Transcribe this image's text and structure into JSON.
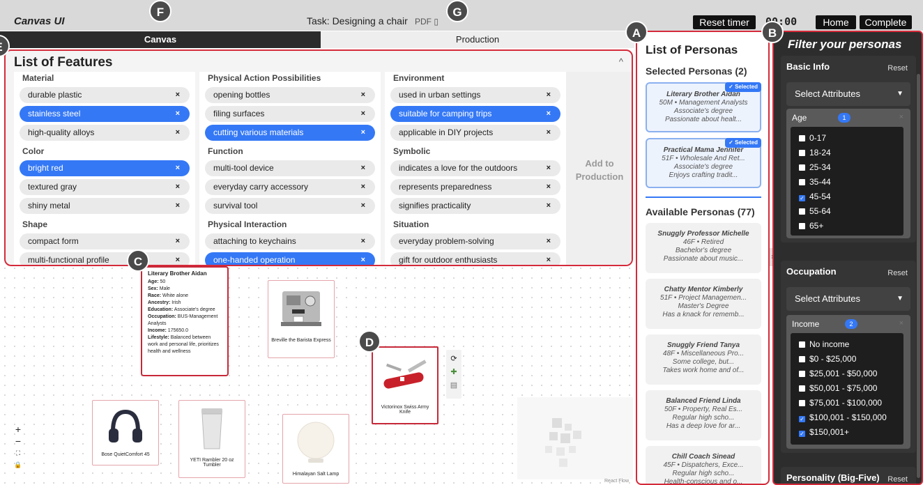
{
  "topbar": {
    "app_title": "Canvas UI",
    "task": "Task: Designing a chair",
    "pdf_label": "PDF",
    "reset_timer": "Reset timer",
    "timer": "00:00",
    "home": "Home",
    "complete": "Complete"
  },
  "tabs": {
    "canvas": "Canvas",
    "production": "Production"
  },
  "badges": {
    "a": "A",
    "b": "B",
    "c": "C",
    "d": "D",
    "e": "E",
    "f": "F",
    "g": "G"
  },
  "features": {
    "title": "List of Features",
    "add_to_production": "Add to Production",
    "columns": [
      {
        "sections": [
          {
            "name": "Material",
            "items": [
              "durable plastic",
              "stainless steel",
              "high-quality alloys"
            ]
          },
          {
            "name": "Color",
            "items": [
              "bright red",
              "textured gray",
              "shiny metal"
            ]
          },
          {
            "name": "Shape",
            "items": [
              "compact form",
              "multi-functional profile"
            ]
          }
        ]
      },
      {
        "sections": [
          {
            "name": "Physical Action Possibilities",
            "items": [
              "opening bottles",
              "filing surfaces",
              "cutting various materials"
            ]
          },
          {
            "name": "Function",
            "items": [
              "multi-tool device",
              "everyday carry accessory",
              "survival tool"
            ]
          },
          {
            "name": "Physical Interaction",
            "items": [
              "attaching to keychains",
              "one-handed operation"
            ]
          }
        ]
      },
      {
        "sections": [
          {
            "name": "Environment",
            "items": [
              "used in urban settings",
              "suitable for camping trips",
              "applicable in DIY projects"
            ]
          },
          {
            "name": "Symbolic",
            "items": [
              "indicates a love for the outdoors",
              "represents preparedness",
              "signifies practicality"
            ]
          },
          {
            "name": "Situation",
            "items": [
              "everyday problem-solving",
              "gift for outdoor enthusiasts"
            ]
          }
        ]
      }
    ]
  },
  "canvas": {
    "info": {
      "name": "Literary Brother Aidan",
      "age_label": "Age:",
      "age": "50",
      "sex_label": "Sex:",
      "sex": "Male",
      "race_label": "Race:",
      "race": "White alone",
      "ancestry_label": "Ancestry:",
      "ancestry": "Irish",
      "education_label": "Education:",
      "education": "Associate's degree",
      "occupation_label": "Occupation:",
      "occupation": "BUS-Management Analysts",
      "income_label": "Income:",
      "income": "175650.0",
      "lifestyle_label": "Lifestyle:",
      "lifestyle": "Balanced between work and personal life, prioritizes health and wellness"
    },
    "products": {
      "espresso": "Breville the Barista Express",
      "knife": "Victorinox Swiss Army Knife",
      "headphones": "Bose QuietComfort 45",
      "tumbler": "YETI Rambler 20 oz Tumbler",
      "lamp": "Himalayan Salt Lamp"
    },
    "react_flow": "React Flow",
    "controls": {
      "zoom_in": "+",
      "zoom_out": "−",
      "fit": "⛶",
      "lock": "🔒"
    }
  },
  "personas": {
    "title": "List of Personas",
    "selected_header": "Selected Personas (2)",
    "selected_tag": "✓ Selected",
    "available_header": "Available Personas (77)",
    "selected": [
      {
        "name": "Literary Brother Aidan",
        "l1": "50M • Management Analysts",
        "l2": "Associate's degree",
        "l3": "Passionate about healt..."
      },
      {
        "name": "Practical Mama Jennifer",
        "l1": "51F • Wholesale And Ret...",
        "l2": "Associate's degree",
        "l3": "Enjoys crafting tradit..."
      }
    ],
    "available": [
      {
        "name": "Snuggly Professor Michelle",
        "l1": "46F • Retired",
        "l2": "Bachelor's degree",
        "l3": "Passionate about music..."
      },
      {
        "name": "Chatty Mentor Kimberly",
        "l1": "51F • Project Managemen...",
        "l2": "Master's Degree",
        "l3": "Has a knack for rememb..."
      },
      {
        "name": "Snuggly Friend Tanya",
        "l1": "48F • Miscellaneous Pro...",
        "l2": "Some college, but...",
        "l3": "Takes work home and of..."
      },
      {
        "name": "Balanced Friend Linda",
        "l1": "50F • Property, Real Es...",
        "l2": "Regular high scho...",
        "l3": "Has a deep love for ar..."
      },
      {
        "name": "Chill Coach Sinead",
        "l1": "45F • Dispatchers, Exce...",
        "l2": "Regular high scho...",
        "l3": "Health-conscious and o..."
      }
    ]
  },
  "filter": {
    "title": "Filter your personas",
    "reset": "Reset",
    "select_attributes": "Select Attributes",
    "basic_info": {
      "title": "Basic Info",
      "attr": "Age",
      "count": "1",
      "options": [
        {
          "label": "0-17",
          "checked": false
        },
        {
          "label": "18-24",
          "checked": false
        },
        {
          "label": "25-34",
          "checked": false
        },
        {
          "label": "35-44",
          "checked": false
        },
        {
          "label": "45-54",
          "checked": true
        },
        {
          "label": "55-64",
          "checked": false
        },
        {
          "label": "65+",
          "checked": false
        }
      ]
    },
    "occupation": {
      "title": "Occupation",
      "attr": "Income",
      "count": "2",
      "options": [
        {
          "label": "No income",
          "checked": false
        },
        {
          "label": "$0 - $25,000",
          "checked": false
        },
        {
          "label": "$25,001 - $50,000",
          "checked": false
        },
        {
          "label": "$50,001 - $75,000",
          "checked": false
        },
        {
          "label": "$75,001 - $100,000",
          "checked": false
        },
        {
          "label": "$100,001 - $150,000",
          "checked": true
        },
        {
          "label": "$150,001+",
          "checked": true
        }
      ]
    },
    "personality": {
      "title": "Personality (Big-Five)"
    }
  }
}
